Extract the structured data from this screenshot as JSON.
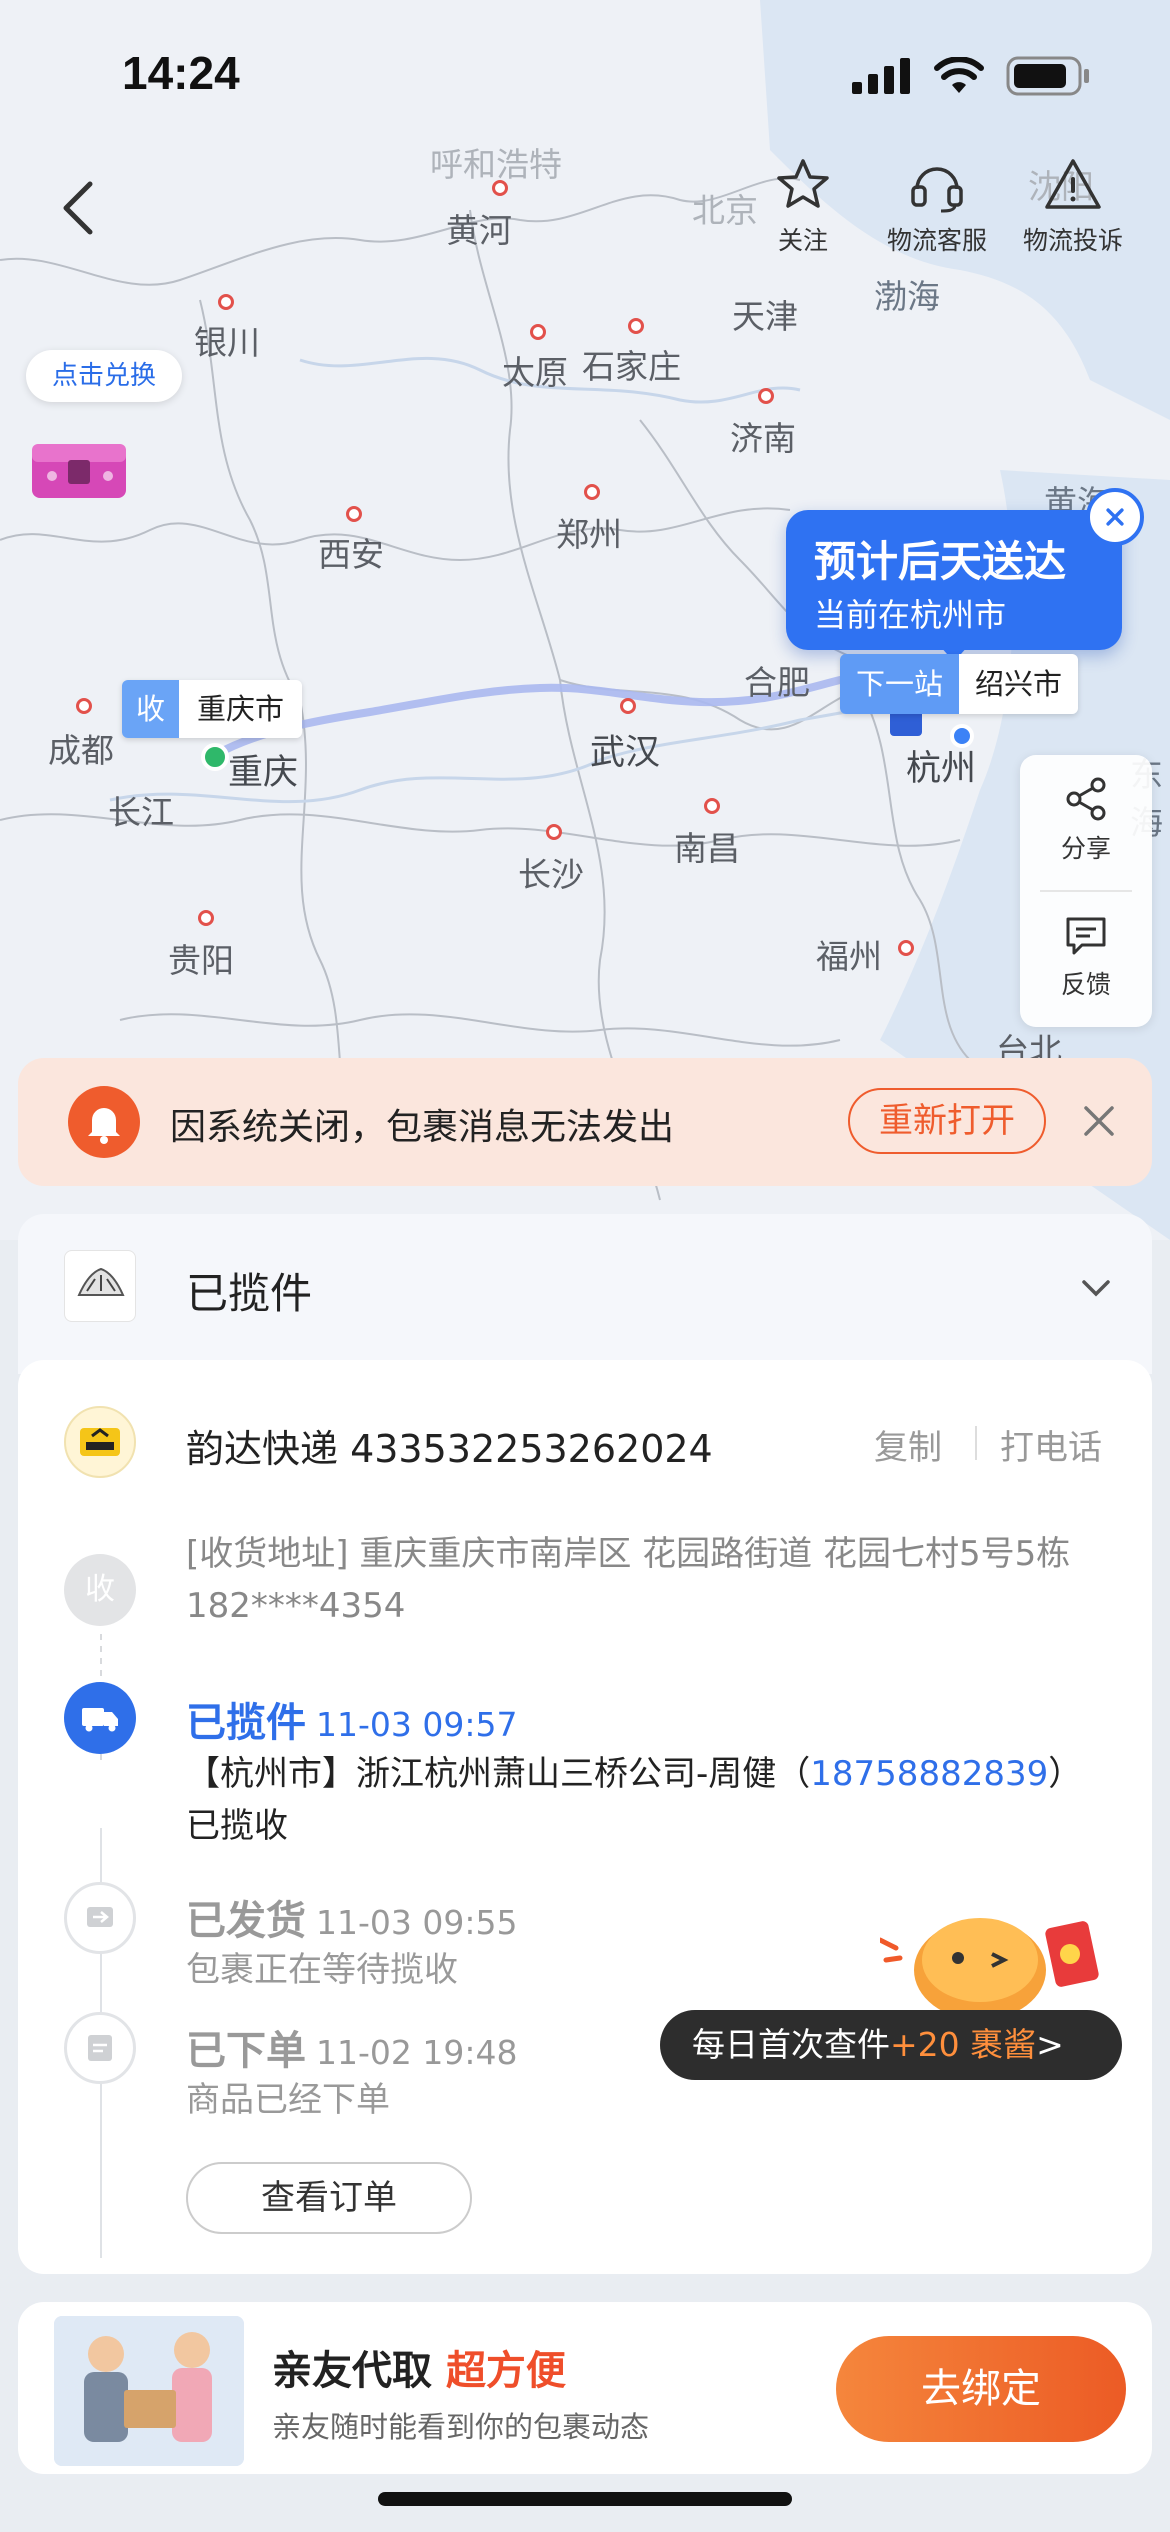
{
  "status_bar": {
    "time": "14:24"
  },
  "top_actions": {
    "follow": "关注",
    "service": "物流客服",
    "complaint": "物流投诉"
  },
  "map": {
    "cities": [
      {
        "name": "呼和浩特",
        "faint": true
      },
      {
        "name": "黄河"
      },
      {
        "name": "北京",
        "faint": true
      },
      {
        "name": "沈阳",
        "faint": true
      },
      {
        "name": "银川"
      },
      {
        "name": "天津"
      },
      {
        "name": "渤海"
      },
      {
        "name": "太原"
      },
      {
        "name": "石家庄"
      },
      {
        "name": "济南"
      },
      {
        "name": "西安"
      },
      {
        "name": "郑州"
      },
      {
        "name": "黄海"
      },
      {
        "name": "合肥"
      },
      {
        "name": "成都"
      },
      {
        "name": "重庆"
      },
      {
        "name": "长江"
      },
      {
        "name": "武汉"
      },
      {
        "name": "杭州"
      },
      {
        "name": "东海"
      },
      {
        "name": "南昌"
      },
      {
        "name": "长沙"
      },
      {
        "name": "福州"
      },
      {
        "name": "贵阳"
      },
      {
        "name": "台北"
      }
    ],
    "redeem_label": "点击兑换",
    "callout_title": "预计后天送达",
    "callout_sub": "当前在杭州市",
    "next_stop_label": "下一站",
    "next_stop_city": "绍兴市",
    "recv_label": "收",
    "recv_city": "重庆市",
    "share": "分享",
    "feedback": "反馈",
    "colors": {
      "route": "#aab8f0",
      "accent": "#2f72f2"
    }
  },
  "notice": {
    "message": "因系统关闭，包裹消息无法发出",
    "reopen": "重新打开"
  },
  "status_card": {
    "title": "已揽件"
  },
  "detail": {
    "carrier": "韵达快递 433532253262024",
    "copy": "复制",
    "call": "打电话",
    "recv_badge": "收",
    "address": "[收货地址] 重庆重庆市南岸区 花园路街道 花园七村5号5栋 182****4354",
    "events": [
      {
        "title": "已揽件",
        "time": "11-03 09:57",
        "body_pre": "【杭州市】浙江杭州萧山三桥公司-周健（",
        "phone": "18758882839",
        "body_post": "） 已揽收"
      },
      {
        "title": "已发货",
        "time": "11-03 09:55",
        "body": "包裹正在等待揽收"
      },
      {
        "title": "已下单",
        "time": "11-02 19:48",
        "body": "商品已经下单"
      }
    ],
    "view_order": "查看订单",
    "reward_pre": "每日首次查件",
    "reward_hl": "+20 裹酱",
    "reward_post": ">"
  },
  "promo": {
    "title": "亲友代取 ",
    "title_hl": "超方便",
    "subtitle": "亲友随时能看到你的包裹动态",
    "button": "去绑定"
  }
}
